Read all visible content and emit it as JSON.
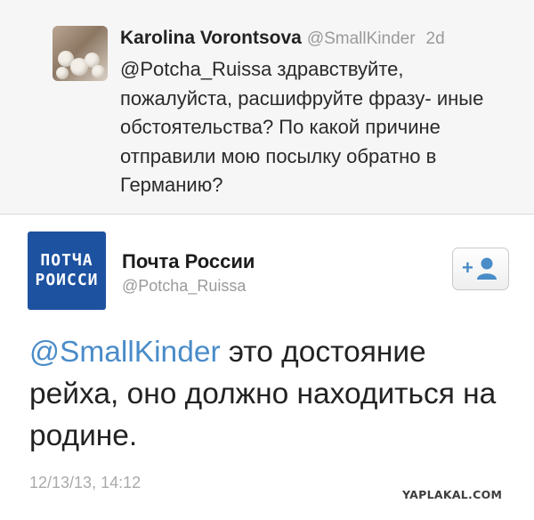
{
  "reply_tweet": {
    "name": "Karolina Vorontsova",
    "handle": "@SmallKinder",
    "time": "2d",
    "text": "@Potcha_Ruissa здравствуйте, пожалуйста, расшифруйте фразу- иные обстоятельства? По какой причине отправили мою посылку обратно в Германию?"
  },
  "main_tweet": {
    "avatar_text_line1": "ПОТЧА",
    "avatar_text_line2": "РОИССИ",
    "name": "Почта России",
    "handle": "@Potcha_Ruissa",
    "follow_icon": "add-user-icon",
    "follow_plus": "+",
    "mention": "@SmallKinder",
    "text_after_mention": " это достояние рейха, оно должно находиться на родине.",
    "timestamp": "12/13/13, 14:12"
  },
  "watermark": "YAPLAKAL.COM",
  "colors": {
    "link": "#4a8cc8",
    "avatar_blue": "#1d52a0",
    "muted": "#9a9a9a",
    "reply_bg": "#f6f6f6"
  }
}
